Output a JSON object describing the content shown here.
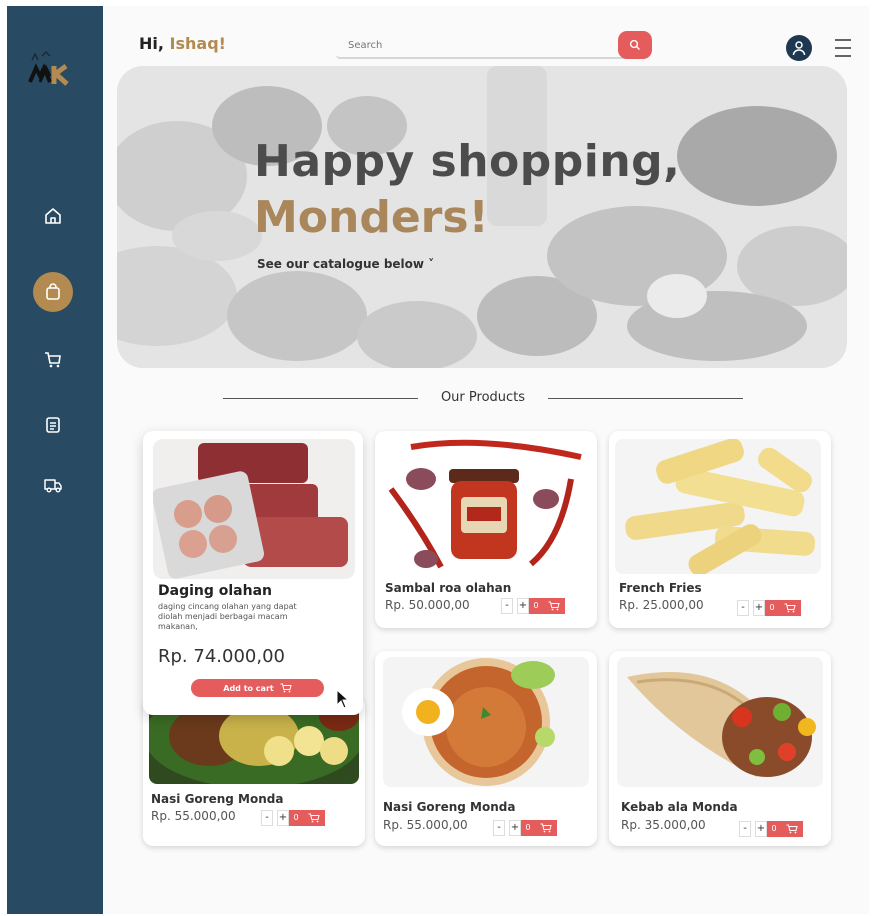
{
  "sidebar": {
    "logo_text": "MK",
    "items": [
      {
        "icon": "home-icon"
      },
      {
        "icon": "shopping-bag-icon",
        "active": true
      },
      {
        "icon": "cart-icon"
      },
      {
        "icon": "orders-list-icon"
      },
      {
        "icon": "delivery-truck-icon"
      }
    ]
  },
  "header": {
    "greeting_prefix": "Hi, ",
    "greeting_name": "Ishaq!",
    "search_placeholder": "Search"
  },
  "hero": {
    "title_line1": "Happy shopping,",
    "title_line2": "Monders!",
    "subtitle": "See our catalogue below ˅"
  },
  "products_section": {
    "title": "Our Products"
  },
  "featured": {
    "name": "Daging olahan",
    "description": "daging cincang olahan yang dapat diolah menjadi berbagai macam makanan,",
    "price": "Rp. 74.000,00",
    "add_to_cart": "Add to cart"
  },
  "products": [
    {
      "name": "Sambal roa olahan",
      "price": "Rp. 50.000,00",
      "qty": "0"
    },
    {
      "name": "French Fries",
      "price": "Rp. 25.000,00",
      "qty": "0"
    },
    {
      "name": "Nasi Goreng Monda",
      "price": "Rp. 55.000,00",
      "qty": "0"
    },
    {
      "name": "Nasi Goreng Monda",
      "price": "Rp. 55.000,00",
      "qty": "0"
    },
    {
      "name": "Kebab ala Monda",
      "price": "Rp. 35.000,00",
      "qty": "0"
    }
  ],
  "colors": {
    "sidebar": "#284a63",
    "accent_gold": "#b38a4f",
    "accent_red": "#e45c5c"
  }
}
